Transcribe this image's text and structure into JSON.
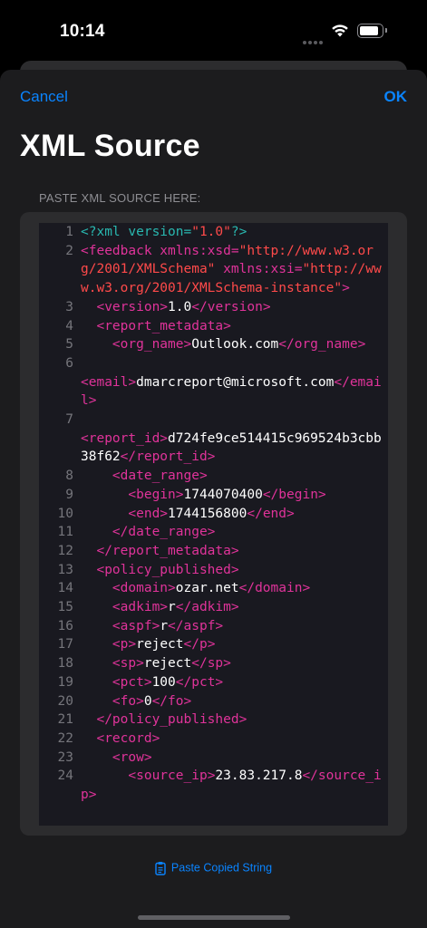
{
  "status_bar": {
    "time": "10:14"
  },
  "nav": {
    "cancel_label": "Cancel",
    "ok_label": "OK"
  },
  "title": "XML Source",
  "section_header": "PASTE XML SOURCE HERE:",
  "paste_button_label": "Paste Copied String",
  "colors": {
    "accent": "#0a84ff",
    "tag": "#e0339a",
    "declaration": "#29b8b0",
    "attr_value": "#ff4a4a"
  },
  "code_lines": [
    {
      "n": "1",
      "tokens": [
        {
          "t": "decl",
          "v": "<?xml version="
        },
        {
          "t": "val",
          "v": "\"1.0\""
        },
        {
          "t": "decl",
          "v": "?>"
        }
      ]
    },
    {
      "n": "2",
      "tokens": [
        {
          "t": "tag",
          "v": "<feedback xmlns:xsd="
        },
        {
          "t": "val",
          "v": "\"http://www.w3.org/2001/XMLSchema\""
        },
        {
          "t": "tag",
          "v": " xmlns:xsi="
        },
        {
          "t": "val",
          "v": "\"http://www.w3.org/2001/XMLSchema-instance\""
        },
        {
          "t": "tag",
          "v": ">"
        }
      ]
    },
    {
      "n": "3",
      "tokens": [
        {
          "t": "txt",
          "v": "  "
        },
        {
          "t": "tag",
          "v": "<version>"
        },
        {
          "t": "txt",
          "v": "1.0"
        },
        {
          "t": "tag",
          "v": "</version>"
        }
      ]
    },
    {
      "n": "4",
      "tokens": [
        {
          "t": "txt",
          "v": "  "
        },
        {
          "t": "tag",
          "v": "<report_metadata>"
        }
      ]
    },
    {
      "n": "5",
      "tokens": [
        {
          "t": "txt",
          "v": "    "
        },
        {
          "t": "tag",
          "v": "<org_name>"
        },
        {
          "t": "txt",
          "v": "Outlook.com"
        },
        {
          "t": "tag",
          "v": "</org_name>"
        }
      ]
    },
    {
      "n": "6",
      "tokens": [
        {
          "t": "txt",
          "v": "    \n"
        },
        {
          "t": "tag",
          "v": "<email>"
        },
        {
          "t": "txt",
          "v": "dmarcreport@microsoft.com"
        },
        {
          "t": "tag",
          "v": "</email>"
        }
      ]
    },
    {
      "n": "7",
      "tokens": [
        {
          "t": "txt",
          "v": "    \n"
        },
        {
          "t": "tag",
          "v": "<report_id>"
        },
        {
          "t": "txt",
          "v": "d724fe9ce514415c969524b3cbb38f62"
        },
        {
          "t": "tag",
          "v": "</report_id>"
        }
      ]
    },
    {
      "n": "8",
      "tokens": [
        {
          "t": "txt",
          "v": "    "
        },
        {
          "t": "tag",
          "v": "<date_range>"
        }
      ]
    },
    {
      "n": "9",
      "tokens": [
        {
          "t": "txt",
          "v": "      "
        },
        {
          "t": "tag",
          "v": "<begin>"
        },
        {
          "t": "txt",
          "v": "1744070400"
        },
        {
          "t": "tag",
          "v": "</begin>"
        }
      ]
    },
    {
      "n": "10",
      "tokens": [
        {
          "t": "txt",
          "v": "      "
        },
        {
          "t": "tag",
          "v": "<end>"
        },
        {
          "t": "txt",
          "v": "1744156800"
        },
        {
          "t": "tag",
          "v": "</end>"
        }
      ]
    },
    {
      "n": "11",
      "tokens": [
        {
          "t": "txt",
          "v": "    "
        },
        {
          "t": "tag",
          "v": "</date_range>"
        }
      ]
    },
    {
      "n": "12",
      "tokens": [
        {
          "t": "txt",
          "v": "  "
        },
        {
          "t": "tag",
          "v": "</report_metadata>"
        }
      ]
    },
    {
      "n": "13",
      "tokens": [
        {
          "t": "txt",
          "v": "  "
        },
        {
          "t": "tag",
          "v": "<policy_published>"
        }
      ]
    },
    {
      "n": "14",
      "tokens": [
        {
          "t": "txt",
          "v": "    "
        },
        {
          "t": "tag",
          "v": "<domain>"
        },
        {
          "t": "txt",
          "v": "ozar.net"
        },
        {
          "t": "tag",
          "v": "</domain>"
        }
      ]
    },
    {
      "n": "15",
      "tokens": [
        {
          "t": "txt",
          "v": "    "
        },
        {
          "t": "tag",
          "v": "<adkim>"
        },
        {
          "t": "txt",
          "v": "r"
        },
        {
          "t": "tag",
          "v": "</adkim>"
        }
      ]
    },
    {
      "n": "16",
      "tokens": [
        {
          "t": "txt",
          "v": "    "
        },
        {
          "t": "tag",
          "v": "<aspf>"
        },
        {
          "t": "txt",
          "v": "r"
        },
        {
          "t": "tag",
          "v": "</aspf>"
        }
      ]
    },
    {
      "n": "17",
      "tokens": [
        {
          "t": "txt",
          "v": "    "
        },
        {
          "t": "tag",
          "v": "<p>"
        },
        {
          "t": "txt",
          "v": "reject"
        },
        {
          "t": "tag",
          "v": "</p>"
        }
      ]
    },
    {
      "n": "18",
      "tokens": [
        {
          "t": "txt",
          "v": "    "
        },
        {
          "t": "tag",
          "v": "<sp>"
        },
        {
          "t": "txt",
          "v": "reject"
        },
        {
          "t": "tag",
          "v": "</sp>"
        }
      ]
    },
    {
      "n": "19",
      "tokens": [
        {
          "t": "txt",
          "v": "    "
        },
        {
          "t": "tag",
          "v": "<pct>"
        },
        {
          "t": "txt",
          "v": "100"
        },
        {
          "t": "tag",
          "v": "</pct>"
        }
      ]
    },
    {
      "n": "20",
      "tokens": [
        {
          "t": "txt",
          "v": "    "
        },
        {
          "t": "tag",
          "v": "<fo>"
        },
        {
          "t": "txt",
          "v": "0"
        },
        {
          "t": "tag",
          "v": "</fo>"
        }
      ]
    },
    {
      "n": "21",
      "tokens": [
        {
          "t": "txt",
          "v": "  "
        },
        {
          "t": "tag",
          "v": "</policy_published>"
        }
      ]
    },
    {
      "n": "22",
      "tokens": [
        {
          "t": "txt",
          "v": "  "
        },
        {
          "t": "tag",
          "v": "<record>"
        }
      ]
    },
    {
      "n": "23",
      "tokens": [
        {
          "t": "txt",
          "v": "    "
        },
        {
          "t": "tag",
          "v": "<row>"
        }
      ]
    },
    {
      "n": "24",
      "tokens": [
        {
          "t": "txt",
          "v": "      "
        },
        {
          "t": "tag",
          "v": "<source_ip>"
        },
        {
          "t": "txt",
          "v": "23.83.217.8"
        },
        {
          "t": "tag",
          "v": "</source_ip>"
        }
      ]
    }
  ]
}
